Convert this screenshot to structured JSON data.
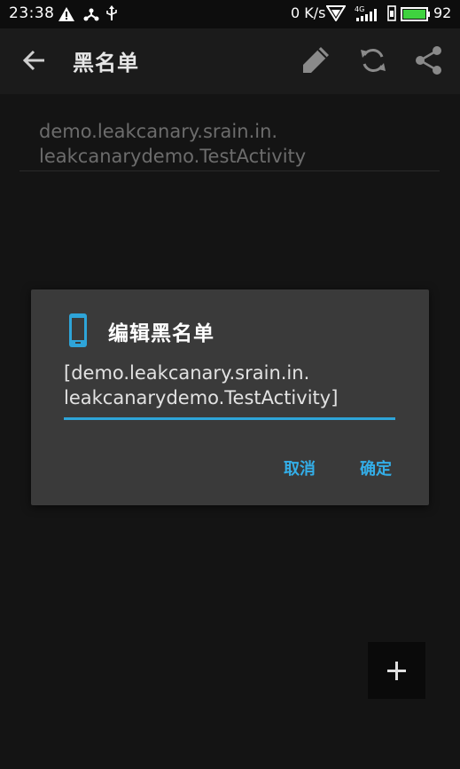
{
  "status_bar": {
    "time": "23:38",
    "left_icons": [
      "warning-icon",
      "usb-share-icon",
      "usb-icon"
    ],
    "net_speed": "0 K/s",
    "signal_label": "4G",
    "battery": "92"
  },
  "app_bar": {
    "title": "黑名单",
    "actions": [
      "edit-icon",
      "refresh-icon",
      "share-icon"
    ]
  },
  "list": {
    "items": [
      {
        "line1": "demo.leakcanary.srain.in.",
        "line2": "leakcanarydemo.TestActivity"
      }
    ]
  },
  "dialog": {
    "title": "编辑黑名单",
    "input_line1": "[demo.leakcanary.srain.in.",
    "input_line2": "leakcanarydemo.TestActivity]",
    "cancel_label": "取消",
    "ok_label": "确定"
  },
  "fab": {
    "label": "+"
  },
  "colors": {
    "accent": "#33aee8",
    "dialog_bg": "#3a3a3a",
    "background": "#141414"
  }
}
